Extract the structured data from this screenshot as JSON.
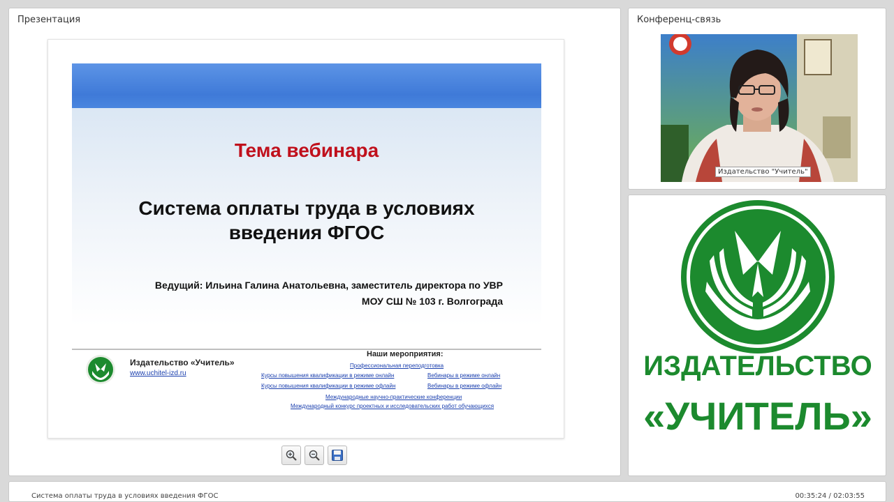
{
  "presentation_panel": {
    "title": "Презентация"
  },
  "slide": {
    "topic_label": "Тема вебинара",
    "title_line1": "Система оплаты труда в условиях",
    "title_line2": "введения ФГОС",
    "presenter_line1": "Ведущий:  Ильина Галина Анатольевна, заместитель директора по УВР",
    "presenter_line2": "МОУ СШ № 103 г. Волгограда",
    "footer": {
      "publisher": "Издательство «Учитель»",
      "url": "www.uchitel-izd.ru",
      "events_heading": "Наши мероприятия:",
      "events": [
        "Профессиональная переподготовка",
        "Курсы повышения квалификации в режиме онлайн",
        "Вебинары в режиме онлайн",
        "Курсы повышения квалификации в режиме офлайн",
        "Вебинары в режиме офлайн",
        "Международные научно-практические конференции",
        "Международный конкурс проектных и исследовательских работ обучающихся"
      ]
    }
  },
  "toolbar": {
    "zoom_in_icon": "zoom-in-icon",
    "zoom_out_icon": "zoom-out-icon",
    "save_icon": "save-icon"
  },
  "conference_panel": {
    "title": "Конференц-связь",
    "video_caption": "Издательство \"Учитель\""
  },
  "logo_panel": {
    "line1": "ИЗДАТЕЛЬСТВО",
    "line2": "«УЧИТЕЛЬ»"
  },
  "status_bar": {
    "title": "Система оплаты труда в условиях введения ФГОС",
    "time": "00:35:24 / 02:03:55"
  },
  "colors": {
    "brand_green": "#1c8a2e",
    "slide_red": "#c0101c",
    "slide_band_blue": "#4a86df",
    "link_blue": "#1a3fae"
  }
}
